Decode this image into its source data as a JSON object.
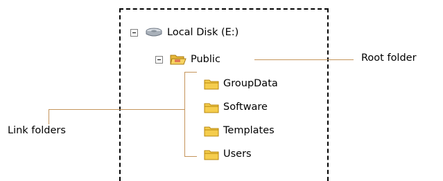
{
  "tree": {
    "drive": {
      "label": "Local Disk (E:)",
      "icon": "drive-icon"
    },
    "root": {
      "label": "Public",
      "icon": "open-folder-icon"
    },
    "children": [
      {
        "label": "GroupData",
        "icon": "folder-icon"
      },
      {
        "label": "Software",
        "icon": "folder-icon"
      },
      {
        "label": "Templates",
        "icon": "folder-icon"
      },
      {
        "label": "Users",
        "icon": "folder-icon"
      }
    ]
  },
  "callouts": {
    "root": "Root folder",
    "links": "Link folders"
  },
  "colors": {
    "connector": "#c4945a",
    "folder": "#f5cd4d",
    "folder_border": "#b8860b"
  }
}
